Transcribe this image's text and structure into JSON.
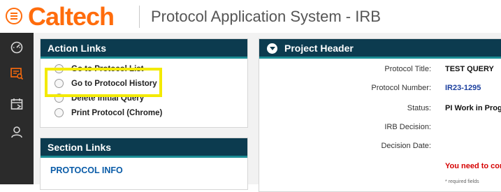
{
  "header": {
    "brand": "Caltech",
    "app_title": "Protocol Application System - IRB"
  },
  "sidebar": {
    "items": [
      {
        "icon": "dashboard-icon"
      },
      {
        "icon": "protocol-list-icon",
        "color": "#ff6c0c"
      },
      {
        "icon": "calendar-icon"
      },
      {
        "icon": "user-icon"
      }
    ]
  },
  "action_links": {
    "title": "Action Links",
    "items": [
      {
        "label": "Go to Protocol List"
      },
      {
        "label": "Go to Protocol History"
      },
      {
        "label": "Delete Initial Query"
      },
      {
        "label": "Print Protocol (Chrome)"
      }
    ]
  },
  "section_links": {
    "title": "Section Links",
    "items": [
      {
        "label": "PROTOCOL INFO"
      }
    ]
  },
  "project_header": {
    "title": "Project Header",
    "fields": [
      {
        "label": "Protocol Title:",
        "value": "TEST QUERY"
      },
      {
        "label": "Protocol Number:",
        "value": "IR23-1295"
      },
      {
        "label": "Status:",
        "value": "PI Work in Prog"
      },
      {
        "label": "IRB Decision:",
        "value": ""
      },
      {
        "label": "Decision Date:",
        "value": ""
      }
    ],
    "warning": "You need to con",
    "footnote": "* required fields"
  },
  "colors": {
    "brand": "#ff6c0c",
    "panel_header": "#0c3b4f",
    "panel_accent": "#1c8d95",
    "highlight": "#f3ea00",
    "link": "#0a5ca8",
    "warning": "#d60000"
  }
}
